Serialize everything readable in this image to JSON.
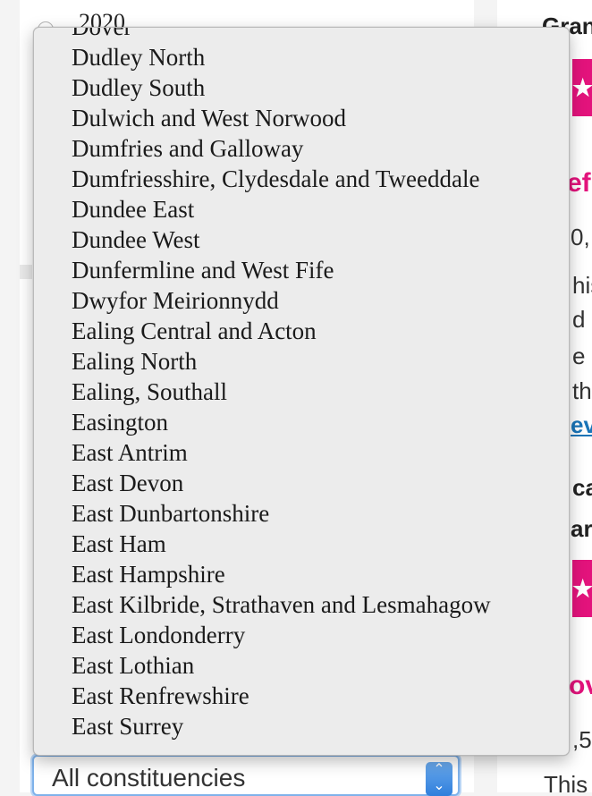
{
  "background": {
    "year_label": "2020",
    "right_column": {
      "heading_1": "Gran",
      "button_1_label": "★ A",
      "pink_title_1": "efu",
      "stat_1": "0,",
      "body_lines": [
        "his",
        "d",
        "e",
        "th"
      ],
      "link_text": "ev",
      "heading_2": "ca",
      "heading_3": "ar",
      "button_2_label": "★ A",
      "pink_title_2": "ov",
      "stat_2": ",5",
      "body_bottom": "This"
    }
  },
  "constituency_select": {
    "selected_value": "All constituencies",
    "options": [
      "Dover",
      "Dudley North",
      "Dudley South",
      "Dulwich and West Norwood",
      "Dumfries and Galloway",
      "Dumfriesshire, Clydesdale and Tweeddale",
      "Dundee East",
      "Dundee West",
      "Dunfermline and West Fife",
      "Dwyfor Meirionnydd",
      "Ealing Central and Acton",
      "Ealing North",
      "Ealing, Southall",
      "Easington",
      "East Antrim",
      "East Devon",
      "East Dunbartonshire",
      "East Ham",
      "East Hampshire",
      "East Kilbride, Strathaven and Lesmahagow",
      "East Londonderry",
      "East Lothian",
      "East Renfrewshire",
      "East Surrey"
    ]
  },
  "colors": {
    "accent_pink": "#e3137c",
    "link_blue": "#1a75b8",
    "focus_blue": "#7fb2ea"
  }
}
